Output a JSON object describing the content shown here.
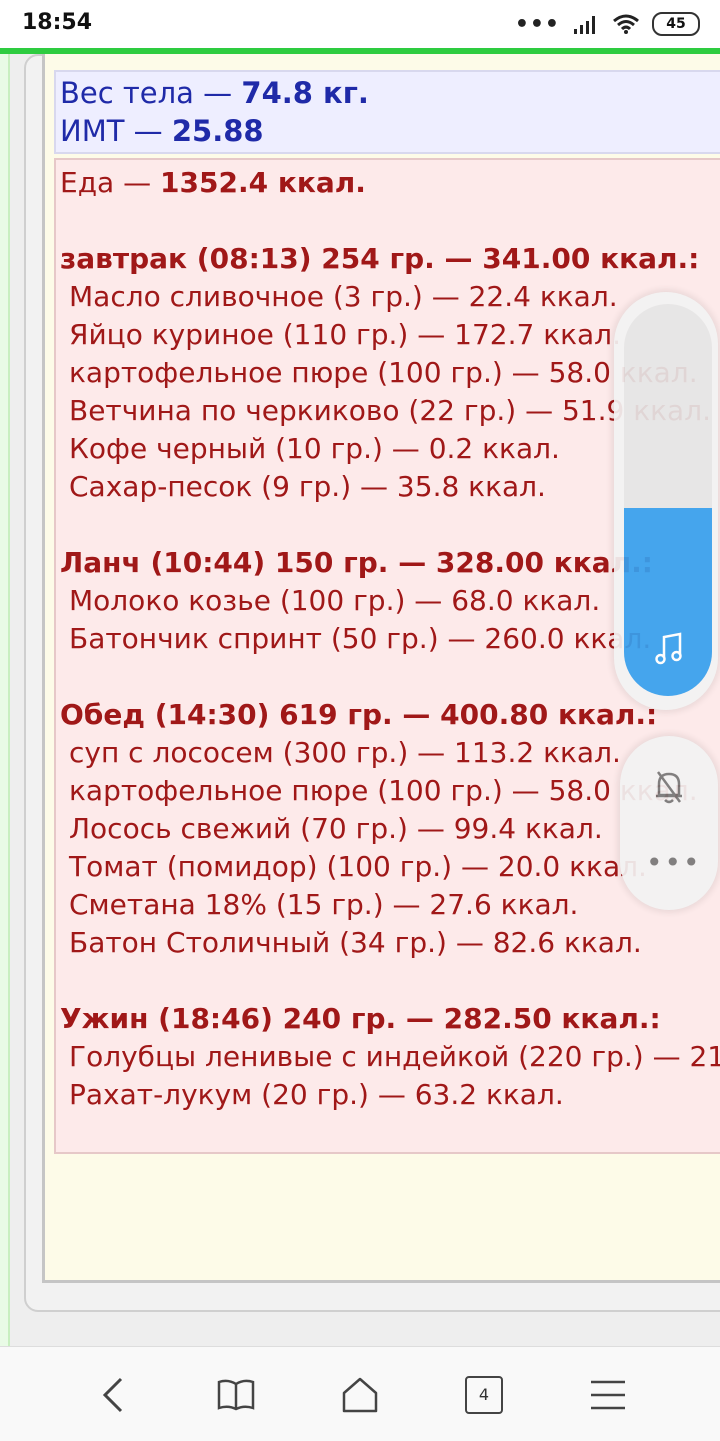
{
  "status_bar": {
    "time": "18:54",
    "dots": "•••",
    "battery": "45"
  },
  "weight": {
    "body_weight_label": "Вес тела — ",
    "body_weight_value": "74.8 кг.",
    "bmi_label": "ИМТ — ",
    "bmi_value": "25.88"
  },
  "food": {
    "total_label": "Еда — ",
    "total_value": "1352.4 ккал.",
    "meals": [
      {
        "header": "завтрак (08:13) 254 гр. — 341.00 ккал.:",
        "items": [
          "Масло сливочное (3 гр.) — 22.4 ккал.",
          "Яйцо куриное (110 гр.) — 172.7 ккал.",
          "картофельное пюре (100 гр.) — 58.0 ккал.",
          "Ветчина по черкиково (22 гр.) — 51.9 ккал.",
          "Кофе черный (10 гр.) — 0.2 ккал.",
          "Сахар-песок (9 гр.) — 35.8 ккал."
        ]
      },
      {
        "header": "Ланч (10:44) 150 гр. — 328.00 ккал.:",
        "items": [
          "Молоко козье (100 гр.) — 68.0 ккал.",
          "Батончик спринт (50 гр.) — 260.0 ккал."
        ]
      },
      {
        "header": "Обед (14:30) 619 гр. — 400.80 ккал.:",
        "items": [
          "суп с лососем (300 гр.) — 113.2 ккал.",
          "картофельное пюре (100 гр.) — 58.0 ккал.",
          "Лосось свежий (70 гр.) — 99.4 ккал.",
          "Томат (помидор) (100 гр.) — 20.0 ккал.",
          "Сметана 18% (15 гр.) — 27.6 ккал.",
          "Батон Столичный (34 гр.) — 82.6 ккал."
        ]
      },
      {
        "header": "Ужин (18:46) 240 гр. — 282.50 ккал.:",
        "items": [
          "Голубцы ленивые с индейкой (220 гр.) — 21",
          "Рахат-лукум (20 гр.) — 63.2 ккал."
        ]
      }
    ]
  },
  "volume": {
    "level_fraction": 0.48,
    "more_label": "•••"
  },
  "navbar": {
    "tabs_count": "4"
  },
  "colors": {
    "accent_green": "#2ecc40",
    "weight_text": "#1f2aa8",
    "food_text": "#a01818",
    "volume_fill": "#36a0ee"
  }
}
